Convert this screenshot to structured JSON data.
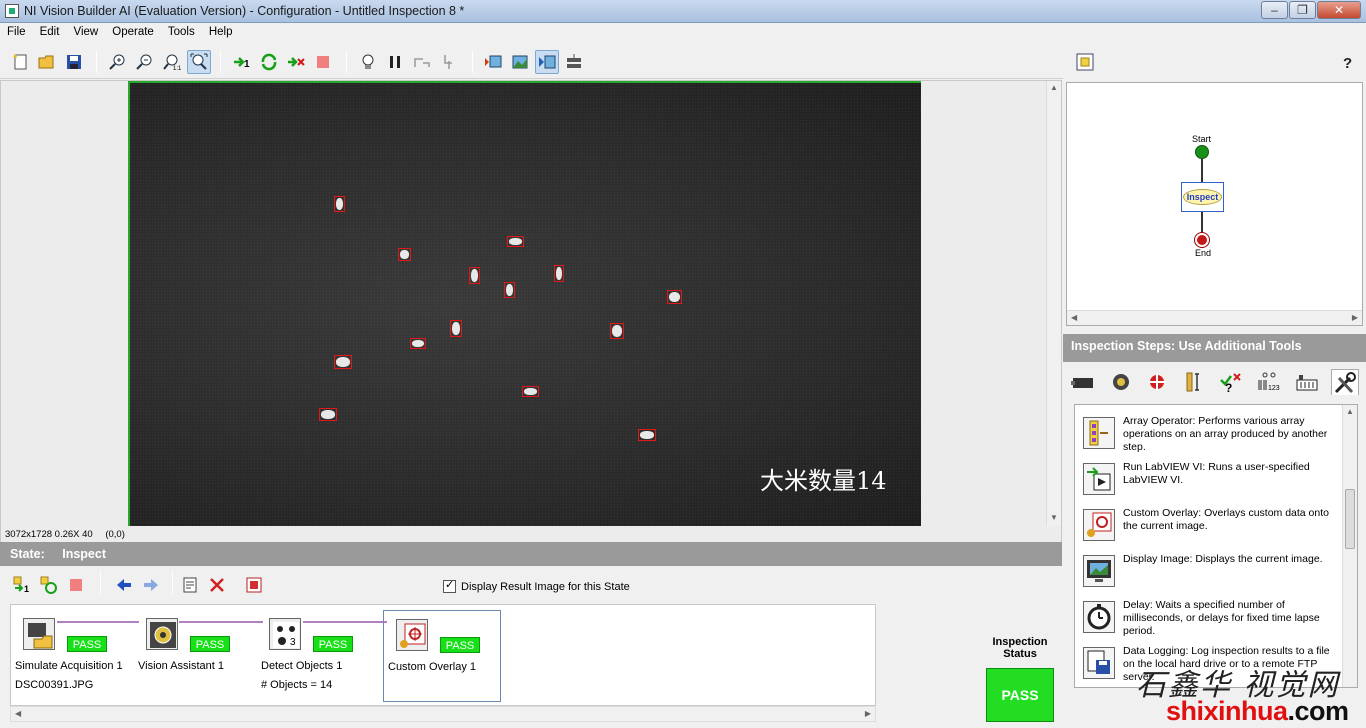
{
  "window": {
    "title": "NI Vision Builder AI (Evaluation Version) - Configuration - Untitled Inspection 8 *"
  },
  "menu": [
    "File",
    "Edit",
    "View",
    "Operate",
    "Tools",
    "Help"
  ],
  "viewer": {
    "overlay_text": "大米数量14",
    "image_info": "3072x1728 0.26X 40",
    "cursor_coords": "(0,0)"
  },
  "state": {
    "label": "State:",
    "name": "Inspect",
    "display_result_label": "Display Result Image for this State",
    "display_result_checked": true
  },
  "steps": [
    {
      "name": "Simulate Acquisition 1",
      "status": "PASS",
      "detail": "DSC00391.JPG",
      "icon": "camera-folder-icon"
    },
    {
      "name": "Vision Assistant 1",
      "status": "PASS",
      "detail": "",
      "icon": "vision-assistant-icon"
    },
    {
      "name": "Detect Objects 1",
      "status": "PASS",
      "detail": "# Objects = 14",
      "icon": "detect-objects-icon"
    },
    {
      "name": "Custom Overlay 1",
      "status": "PASS",
      "detail": "",
      "icon": "custom-overlay-icon"
    }
  ],
  "inspection_status": {
    "label": "Inspection Status",
    "value": "PASS"
  },
  "diagram": {
    "start": "Start",
    "inspect": "Inspect",
    "end": "End"
  },
  "tools_panel": {
    "header": "Inspection Steps: Use Additional Tools",
    "tools": [
      {
        "name": "array-operator",
        "text": "Array Operator:  Performs various array operations on an array produced by another step."
      },
      {
        "name": "run-labview-vi",
        "text": "Run LabVIEW VI:  Runs a user-specified LabVIEW VI."
      },
      {
        "name": "custom-overlay",
        "text": "Custom Overlay:  Overlays custom data onto the current image."
      },
      {
        "name": "display-image",
        "text": "Display Image:  Displays the current image."
      },
      {
        "name": "delay",
        "text": "Delay:  Waits a specified number of milliseconds, or delays for fixed time lapse period."
      },
      {
        "name": "data-logging",
        "text": "Data Logging:  Log inspection results to a file on the local hard drive or to a remote FTP server."
      }
    ]
  },
  "watermark": {
    "calligraphy": "石鑫华 视觉网",
    "site": "shixinhua",
    "ext": ".com"
  },
  "colors": {
    "pass_green": "#22dd22",
    "overlay_red": "#e01818",
    "header_gray": "#9a9a9a"
  }
}
